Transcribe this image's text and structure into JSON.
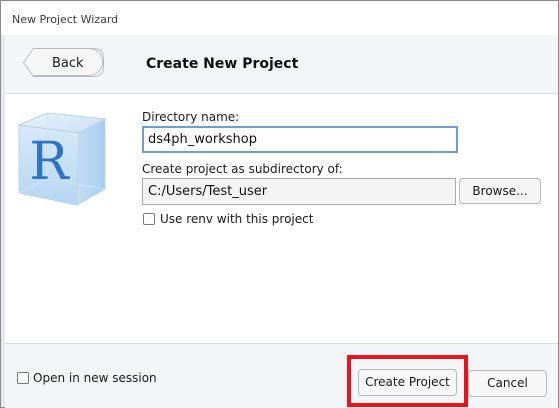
{
  "window": {
    "title": "New Project Wizard"
  },
  "header": {
    "back_label": "Back",
    "title": "Create New Project"
  },
  "form": {
    "directory_label": "Directory name:",
    "directory_value": "ds4ph_workshop",
    "subdir_label": "Create project as subdirectory of:",
    "subdir_value": "C:/Users/Test_user",
    "browse_label": "Browse...",
    "renv_label": "Use renv with this project",
    "renv_checked": false
  },
  "footer": {
    "open_new_session_label": "Open in new session",
    "open_new_session_checked": false,
    "create_label": "Create Project",
    "cancel_label": "Cancel"
  },
  "logo": {
    "letter": "R"
  },
  "colors": {
    "highlight": "#e8141b",
    "focus_border": "#6b9fd6",
    "logo_blue": "#2f73c5"
  }
}
